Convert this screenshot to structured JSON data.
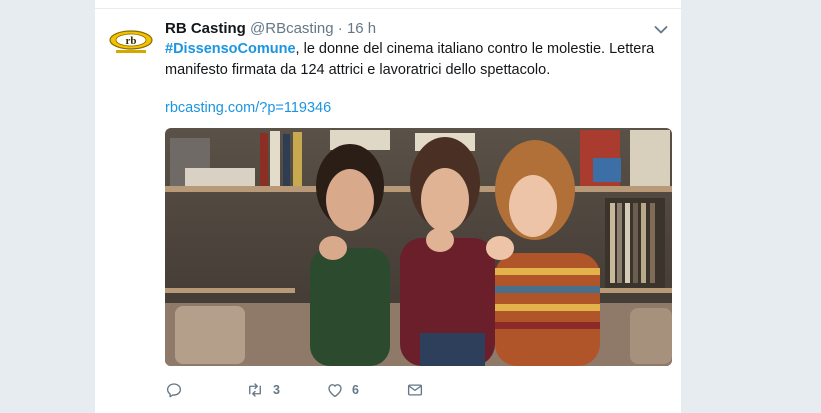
{
  "tweet": {
    "display_name": "RB Casting",
    "handle": "@RBcasting",
    "separator": "·",
    "time": "16 h",
    "hashtag": "#DissensoComune",
    "text_rest": ", le donne del cinema italiano contro le molestie. Lettera manifesto firmata da 124 attrici e lavoratrici dello spettacolo.",
    "link": "rbcasting.com/?p=119346",
    "avatar_text": "rb"
  },
  "actions": {
    "reply_count": "",
    "retweet_count": "3",
    "like_count": "6"
  },
  "icons": {
    "caret": "chevron-down-icon",
    "reply": "reply-icon",
    "retweet": "retweet-icon",
    "like": "heart-icon",
    "dm": "envelope-icon"
  },
  "colors": {
    "link": "#1b95e0",
    "muted": "#657786",
    "background": "#e6ecf0"
  }
}
